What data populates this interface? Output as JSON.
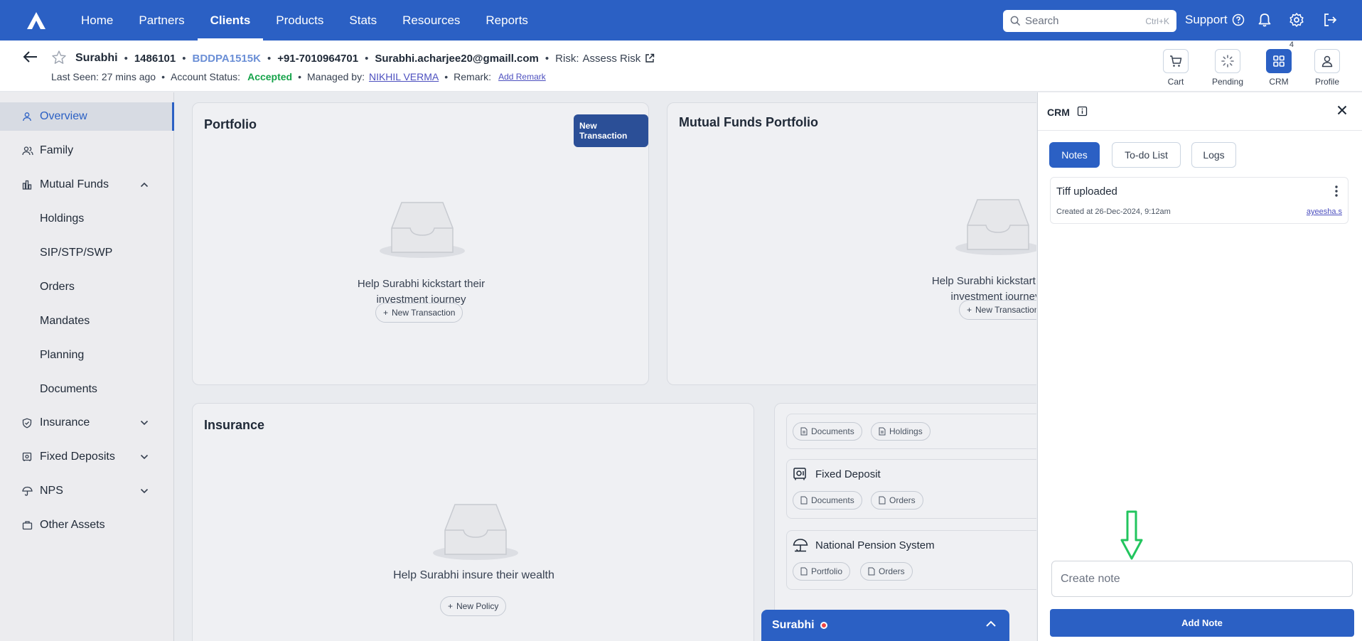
{
  "nav": {
    "items": [
      "Home",
      "Partners",
      "Clients",
      "Products",
      "Stats",
      "Resources",
      "Reports"
    ],
    "active": "Clients",
    "search_placeholder": "Search",
    "search_shortcut": "Ctrl+K",
    "support_label": "Support"
  },
  "client": {
    "name": "Surabhi",
    "id": "1486101",
    "pan": "BDDPA1515K",
    "phone": "+91-7010964701",
    "email": "Surabhi.acharjee20@gmaill.com",
    "risk_label": "Risk:",
    "risk_value": "Assess Risk",
    "last_seen": "Last Seen: 27 mins ago",
    "account_status_label": "Account Status:",
    "account_status": "Accepted",
    "managed_by_label": "Managed by:",
    "managed_by": "NIKHIL VERMA",
    "remark_label": "Remark:",
    "remark_link": "Add Remark"
  },
  "header_actions": [
    {
      "label": "Cart",
      "icon": "cart-icon"
    },
    {
      "label": "Pending",
      "icon": "spinner-icon"
    },
    {
      "label": "CRM",
      "icon": "grid-icon",
      "badge": "4"
    },
    {
      "label": "Profile",
      "icon": "user-icon"
    }
  ],
  "sidebar": {
    "items": [
      {
        "label": "Overview",
        "icon": "user-icon"
      },
      {
        "label": "Family",
        "icon": "users-icon"
      },
      {
        "label": "Mutual Funds",
        "icon": "bank-icon"
      },
      {
        "label": "Holdings"
      },
      {
        "label": "SIP/STP/SWP"
      },
      {
        "label": "Orders"
      },
      {
        "label": "Mandates"
      },
      {
        "label": "Planning"
      },
      {
        "label": "Documents"
      },
      {
        "label": "Insurance",
        "icon": "shield-icon"
      },
      {
        "label": "Fixed Deposits",
        "icon": "safe-icon"
      },
      {
        "label": "NPS",
        "icon": "umbrella-icon"
      },
      {
        "label": "Other Assets",
        "icon": "briefcase-icon"
      }
    ]
  },
  "portfolio": {
    "title": "Portfolio",
    "new_txn_button": "New Transaction",
    "empty_text_1": "Help Surabhi kickstart their",
    "empty_text_2": "investment journey",
    "empty_button": "New Transaction"
  },
  "mf_portfolio": {
    "title": "Mutual Funds Portfolio",
    "empty_text_1": "Help Surabhi kickstart their",
    "empty_text_2": "investment journey",
    "empty_button": "New Transaction"
  },
  "insurance": {
    "title": "Insurance",
    "empty_text": "Help Surabhi insure their wealth",
    "empty_button": "New Policy"
  },
  "products": {
    "top_chips": [
      "Documents",
      "Holdings"
    ],
    "fixed_deposit": {
      "title": "Fixed Deposit",
      "chips": [
        "Documents",
        "Orders"
      ]
    },
    "nps": {
      "title": "National Pension System",
      "chips": [
        "Portfolio",
        "Orders"
      ]
    }
  },
  "chat": {
    "name": "Surabhi"
  },
  "crm": {
    "title": "CRM",
    "tabs": [
      "Notes",
      "To-do List",
      "Logs"
    ],
    "active_tab": "Notes",
    "note": {
      "title": "Tiff uploaded",
      "created": "Created at 26-Dec-2024, 9:12am",
      "author": "ayeesha.s"
    },
    "input_placeholder": "Create note",
    "add_button": "Add Note"
  },
  "colors": {
    "primary": "#2b60c4",
    "accepted": "#16a34a",
    "link": "#4c4fbf",
    "annotation_arrow": "#22c55e"
  }
}
